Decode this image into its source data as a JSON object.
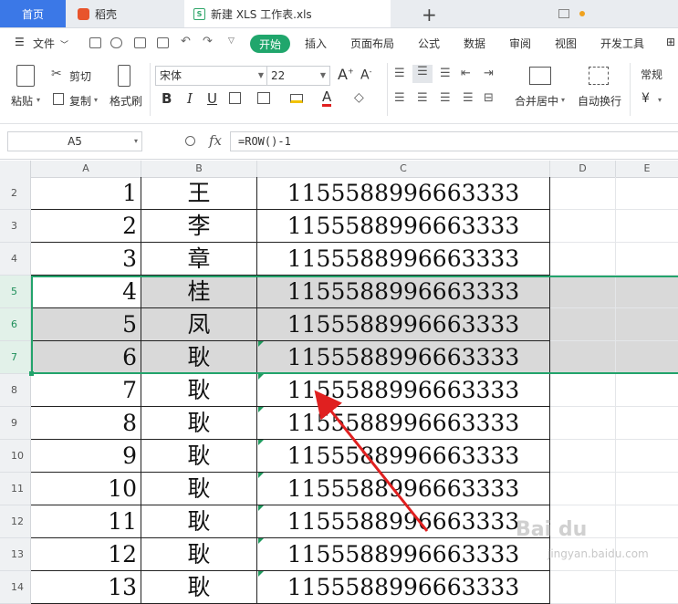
{
  "tabs": [
    {
      "label": "首页"
    },
    {
      "label": "稻壳"
    },
    {
      "label": "新建 XLS 工作表.xls"
    }
  ],
  "menu": {
    "file": "文件",
    "items": [
      "开始",
      "插入",
      "页面布局",
      "公式",
      "数据",
      "审阅",
      "视图",
      "开发工具"
    ]
  },
  "ribbon": {
    "paste": "粘贴",
    "cut": "剪切",
    "copy": "复制",
    "format_painter": "格式刷",
    "font_name": "宋体",
    "font_size": "22",
    "bold": "B",
    "italic": "I",
    "underline": "U",
    "font_color_glyph": "A",
    "grow_glyph": "A",
    "shrink_glyph": "A",
    "merge_center": "合并居中",
    "wrap_text": "自动换行",
    "number_format": "常规",
    "currency": "¥"
  },
  "formula_bar": {
    "name_box": "A5",
    "fx": "fx",
    "formula": "=ROW()-1"
  },
  "columns": [
    "A",
    "B",
    "C",
    "D",
    "E"
  ],
  "rows": [
    {
      "n": "2",
      "a": "1",
      "b": "王",
      "c": "1155588996663333"
    },
    {
      "n": "3",
      "a": "2",
      "b": "李",
      "c": "1155588996663333"
    },
    {
      "n": "4",
      "a": "3",
      "b": "章",
      "c": "1155588996663333"
    },
    {
      "n": "5",
      "a": "4",
      "b": "桂",
      "c": "1155588996663333"
    },
    {
      "n": "6",
      "a": "5",
      "b": "凤",
      "c": "1155588996663333"
    },
    {
      "n": "7",
      "a": "6",
      "b": "耿",
      "c": "1155588996663333"
    },
    {
      "n": "8",
      "a": "7",
      "b": "耿",
      "c": "1155588996663333"
    },
    {
      "n": "9",
      "a": "8",
      "b": "耿",
      "c": "1155588996663333"
    },
    {
      "n": "10",
      "a": "9",
      "b": "耿",
      "c": "1155588996663333"
    },
    {
      "n": "11",
      "a": "10",
      "b": "耿",
      "c": "1155588996663333"
    },
    {
      "n": "12",
      "a": "11",
      "b": "耿",
      "c": "1155588996663333"
    },
    {
      "n": "13",
      "a": "12",
      "b": "耿",
      "c": "1155588996663333"
    },
    {
      "n": "14",
      "a": "13",
      "b": "耿",
      "c": "1155588996663333"
    }
  ],
  "selected_rows": [
    "5",
    "6",
    "7"
  ],
  "active_row": "5",
  "watermark": "Bai du",
  "watermark_sub": "jingyan.baidu.com",
  "colors": {
    "accent": "#20a66c",
    "home_tab": "#3b78e7",
    "selection": "#d9d9d9",
    "arrow": "#e02020"
  }
}
